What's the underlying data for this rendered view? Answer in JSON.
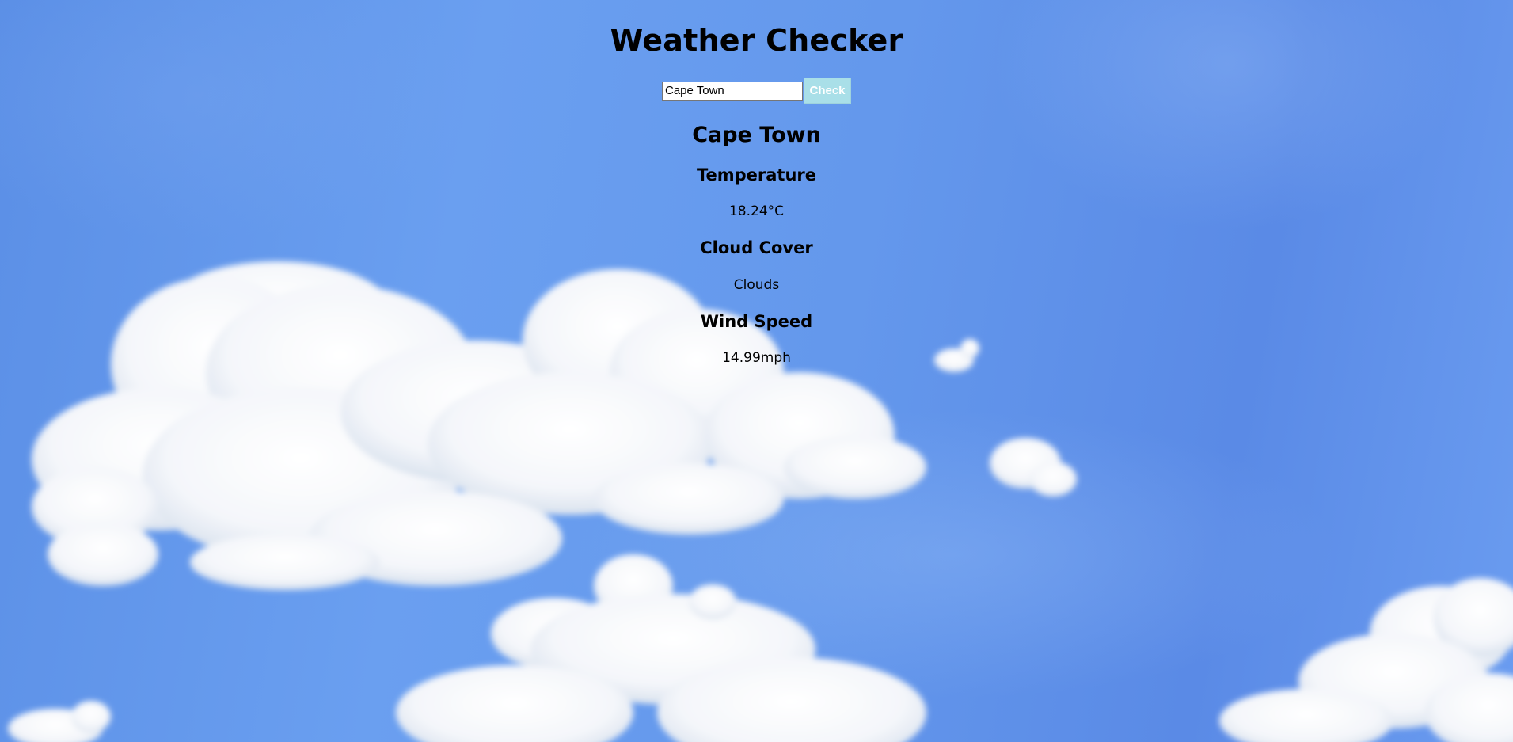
{
  "app": {
    "title": "Weather Checker"
  },
  "search": {
    "value": "Cape Town",
    "button_label": "Check"
  },
  "result": {
    "city": "Cape Town",
    "sections": [
      {
        "heading": "Temperature",
        "value": "18.24°C"
      },
      {
        "heading": "Cloud Cover",
        "value": "Clouds"
      },
      {
        "heading": "Wind Speed",
        "value": "14.99mph"
      }
    ]
  },
  "background": {
    "image": "sky-with-clouds",
    "sky_color": "#5b8fe6",
    "cloud_color": "#ffffff"
  },
  "colors": {
    "button_bg": "#a9dfe8",
    "button_text": "#ffffff"
  }
}
